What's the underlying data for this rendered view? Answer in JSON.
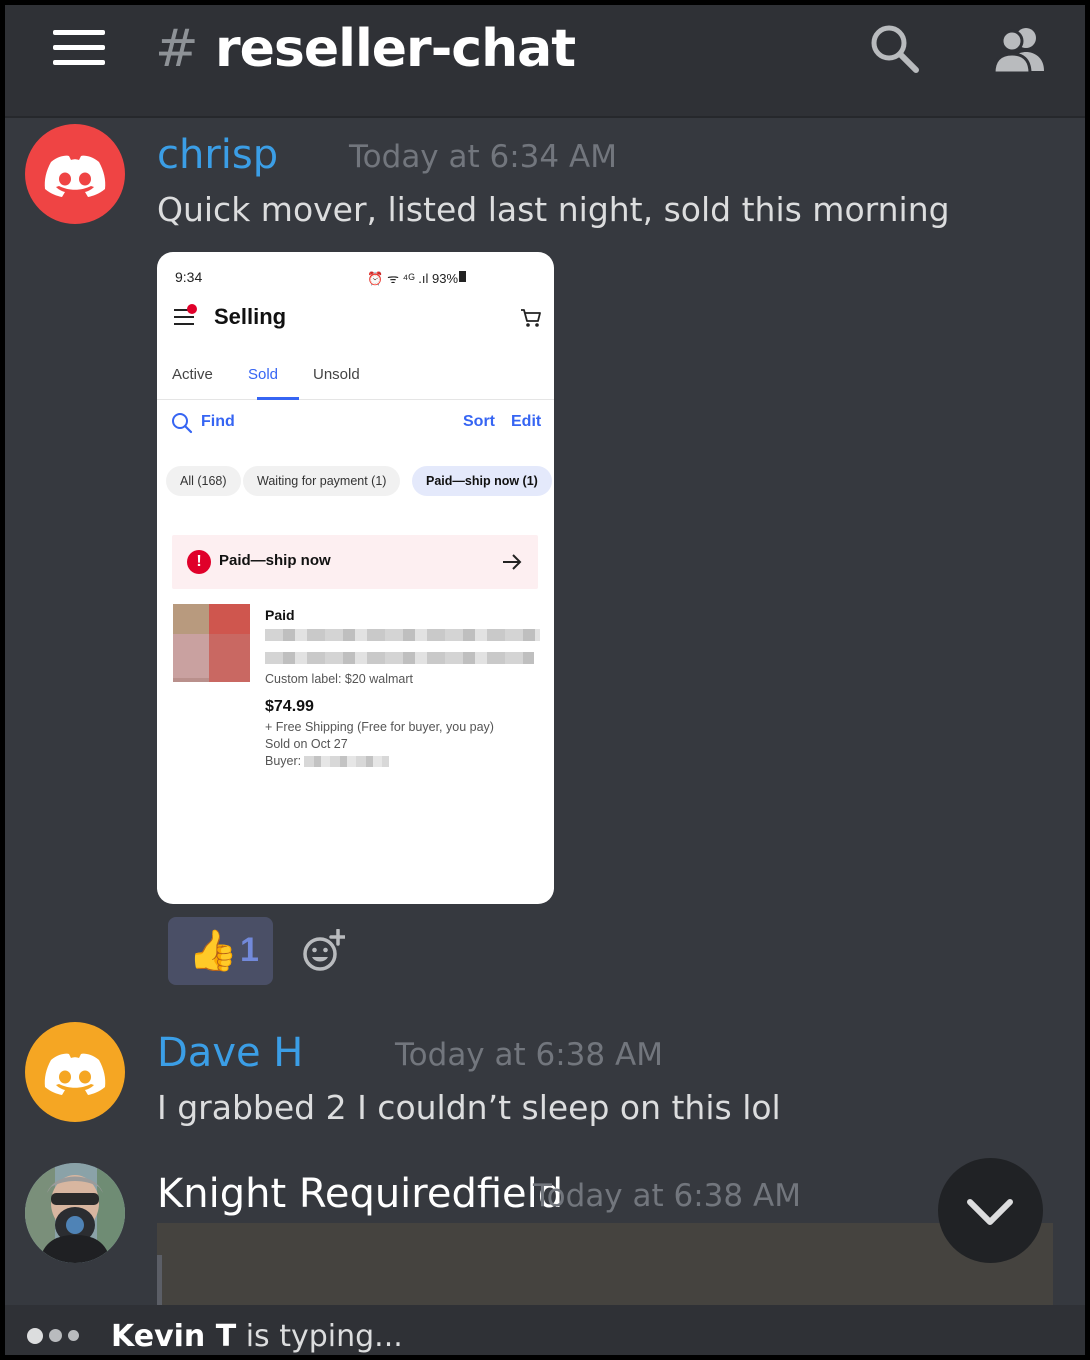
{
  "header": {
    "hash": "#",
    "channel": "reseller-chat",
    "icons": [
      "hamburger-menu-icon",
      "search-icon",
      "members-icon"
    ]
  },
  "messages": [
    {
      "author": "chrisp",
      "author_color": "#3b9ee6",
      "avatar_color": "#ef4444",
      "timestamp": "Today at 6:34 AM",
      "text": "Quick mover, listed last night, sold this morning",
      "attachment": {
        "status_time": "9:34",
        "status_right": "⏰ ᯤ ⁴ᴳ .ıl 93%",
        "title": "Selling",
        "tabs": [
          "Active",
          "Sold",
          "Unsold"
        ],
        "active_tab": "Sold",
        "find": "Find",
        "sort": "Sort",
        "edit": "Edit",
        "chips": [
          "All (168)",
          "Waiting for payment (1)",
          "Paid—ship now (1)"
        ],
        "banner": "Paid—ship now",
        "banner_icon": "!",
        "item": {
          "status": "Paid",
          "custom_label": "Custom label: $20 walmart",
          "price": "$74.99",
          "shipping": "+ Free Shipping (Free for buyer, you pay)",
          "sold_on": "Sold on Oct 27",
          "buyer_label": "Buyer:"
        }
      },
      "reaction": {
        "emoji": "👍",
        "count": "1"
      }
    },
    {
      "author": "Dave H",
      "author_color": "#3b9ee6",
      "avatar_color": "#f5a623",
      "timestamp": "Today at 6:38 AM",
      "text": "I grabbed 2 I couldn’t sleep on this lol"
    },
    {
      "author": "Knight Requiredfield",
      "author_color": "#ffffff",
      "timestamp": "Today at 6:38 AM"
    }
  ],
  "typing": {
    "user": "Kevin T",
    "suffix": " is typing..."
  }
}
